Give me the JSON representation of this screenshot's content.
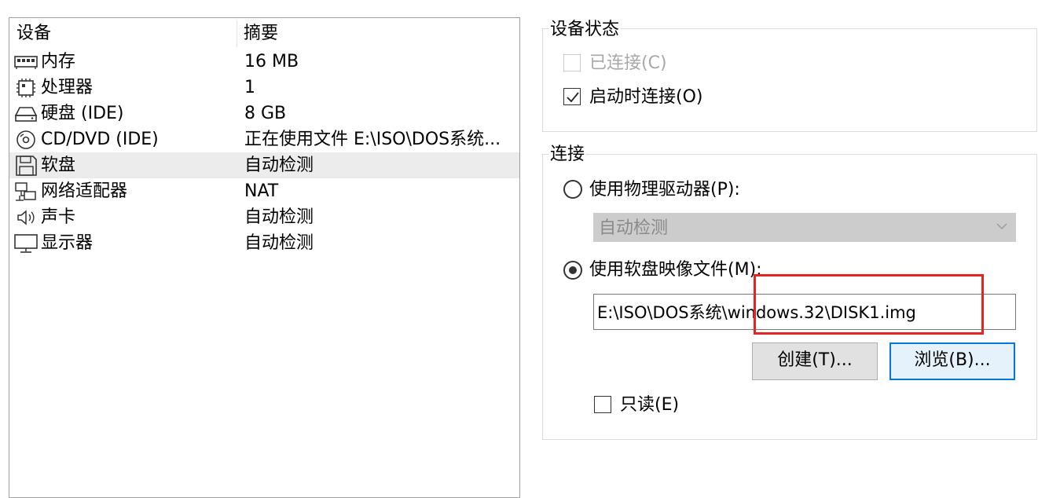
{
  "device_list": {
    "columns": {
      "device": "设备",
      "summary": "摘要"
    },
    "rows": [
      {
        "name": "内存",
        "summary": "16 MB",
        "icon": "memory-icon"
      },
      {
        "name": "处理器",
        "summary": "1",
        "icon": "processor-icon"
      },
      {
        "name": "硬盘 (IDE)",
        "summary": "8 GB",
        "icon": "hard-disk-icon"
      },
      {
        "name": "CD/DVD (IDE)",
        "summary": "正在使用文件 E:\\ISO\\DOS系统...",
        "icon": "cd-dvd-icon"
      },
      {
        "name": "软盘",
        "summary": "自动检测",
        "icon": "floppy-icon",
        "selected": true
      },
      {
        "name": "网络适配器",
        "summary": "NAT",
        "icon": "network-adapter-icon"
      },
      {
        "name": "声卡",
        "summary": "自动检测",
        "icon": "sound-card-icon"
      },
      {
        "name": "显示器",
        "summary": "自动检测",
        "icon": "monitor-icon"
      }
    ]
  },
  "device_status": {
    "legend": "设备状态",
    "connected": {
      "label": "已连接(C)",
      "checked": false,
      "enabled": false
    },
    "connect_at_power_on": {
      "label": "启动时连接(O)",
      "checked": true,
      "enabled": true
    }
  },
  "connection": {
    "legend": "连接",
    "physical_drive": {
      "label": "使用物理驱动器(P):",
      "selected": false
    },
    "drive_combo": {
      "value": "自动检测",
      "enabled": false
    },
    "image_file": {
      "label": "使用软盘映像文件(M):",
      "selected": true
    },
    "image_path": "E:\\ISO\\DOS系统\\windows.32\\DISK1.img",
    "create_button": "创建(T)...",
    "browse_button": "浏览(B)...",
    "read_only": {
      "label": "只读(E)",
      "checked": false
    }
  },
  "colors": {
    "highlight": "#e52420",
    "default_button_border": "#0078d7",
    "selected_row": "#ececec"
  }
}
